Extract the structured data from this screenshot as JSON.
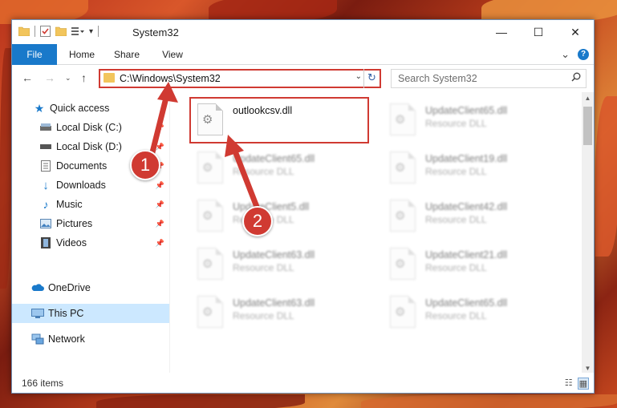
{
  "window": {
    "title": "System32",
    "minimize_glyph": "—",
    "maximize_glyph": "☐",
    "close_glyph": "✕"
  },
  "ribbon": {
    "tabs": [
      "File",
      "Home",
      "Share",
      "View"
    ],
    "expand_glyph": "⌄",
    "help_glyph": "?"
  },
  "address": {
    "path": "C:\\Windows\\System32",
    "refresh_glyph": "↻",
    "dropdown_glyph": "⌄"
  },
  "search": {
    "placeholder": "Search System32",
    "icon": "search-icon"
  },
  "sidebar": {
    "items": [
      {
        "label": "Quick access",
        "icon": "star-icon",
        "pinned": false
      },
      {
        "label": "Local Disk (C:)",
        "icon": "drive-icon",
        "pinned": true
      },
      {
        "label": "Local Disk (D:)",
        "icon": "drive-icon",
        "pinned": true
      },
      {
        "label": "Documents",
        "icon": "documents-icon",
        "pinned": true
      },
      {
        "label": "Downloads",
        "icon": "download-icon",
        "pinned": true
      },
      {
        "label": "Music",
        "icon": "music-icon",
        "pinned": true
      },
      {
        "label": "Pictures",
        "icon": "pictures-icon",
        "pinned": true
      },
      {
        "label": "Videos",
        "icon": "videos-icon",
        "pinned": true
      },
      {
        "label": "OneDrive",
        "icon": "cloud-icon",
        "pinned": false
      },
      {
        "label": "This PC",
        "icon": "computer-icon",
        "pinned": false,
        "selected": true
      },
      {
        "label": "Network",
        "icon": "network-icon",
        "pinned": false
      }
    ]
  },
  "files": {
    "highlighted": {
      "name": "outlookcsv.dll"
    },
    "blurred": [
      {
        "name": "UpdateClient65.dll",
        "type": "Resource DLL"
      },
      {
        "name": "UpdateClient65.dll",
        "type": "Resource DLL"
      },
      {
        "name": "UpdateClient19.dll",
        "type": "Resource DLL"
      },
      {
        "name": "UpdateClient5.dll",
        "type": "Resource DLL"
      },
      {
        "name": "UpdateClient42.dll",
        "type": "Resource DLL"
      },
      {
        "name": "UpdateClient63.dll",
        "type": "Resource DLL"
      },
      {
        "name": "UpdateClient21.dll",
        "type": "Resource DLL"
      },
      {
        "name": "UpdateClient63.dll",
        "type": "Resource DLL"
      },
      {
        "name": "UpdateClient65.dll",
        "type": "Resource DLL"
      }
    ]
  },
  "status": {
    "item_count": "166 items"
  },
  "annotations": {
    "step1": "1",
    "step2": "2",
    "color": "#d03a32"
  }
}
